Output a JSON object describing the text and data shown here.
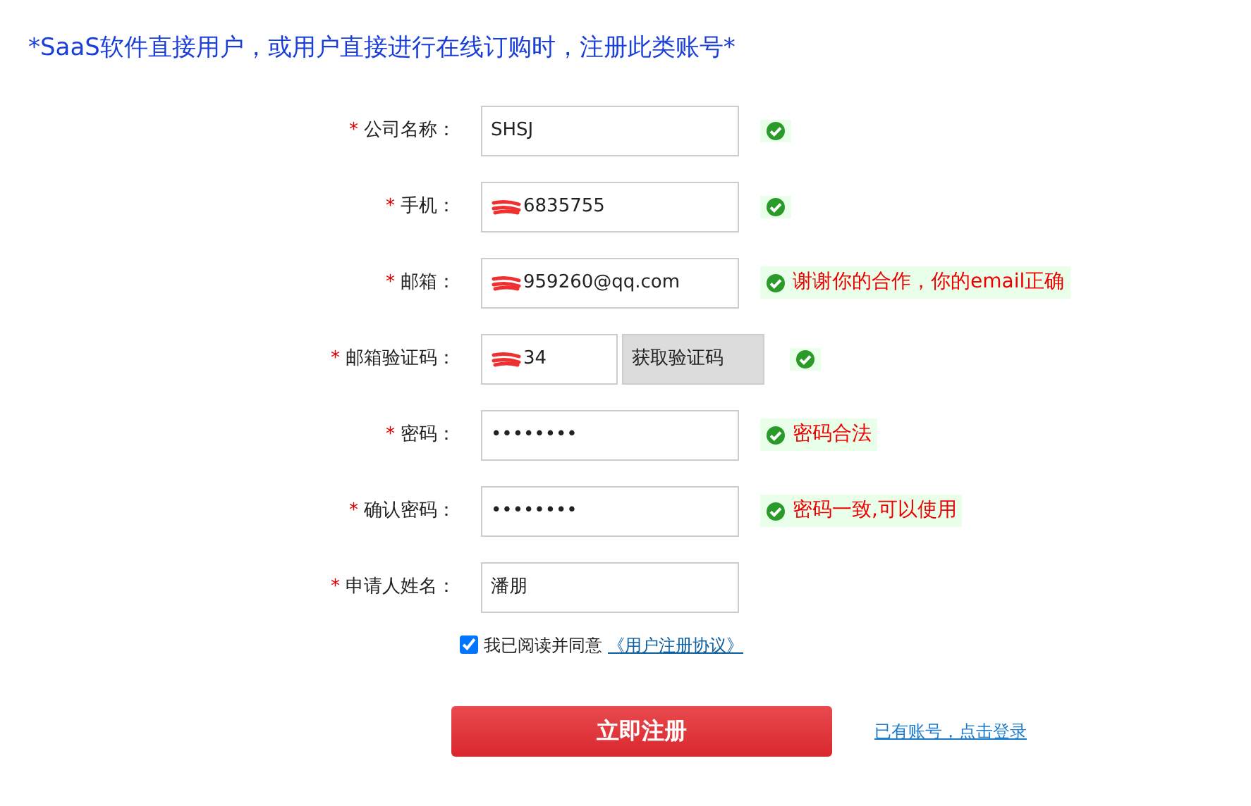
{
  "title": "*SaaS软件直接用户，或用户直接进行在线订购时，注册此类账号*",
  "fields": [
    {
      "kind": "input",
      "mark": "*",
      "label": "公司名称：",
      "value": "SHSJ",
      "redacted": false,
      "valid": true
    },
    {
      "kind": "input",
      "mark": "*",
      "label": "手机：",
      "value": "6835755",
      "redacted": true,
      "valid": true
    },
    {
      "kind": "input",
      "mark": "*",
      "label": "邮箱：",
      "value": "959260@qq.com",
      "redacted": true,
      "valid": true,
      "message": "谢谢你的合作，你的email正确"
    },
    {
      "kind": "code",
      "mark": "*",
      "label": "邮箱验证码：",
      "value": "34",
      "redacted": true,
      "valid": true,
      "button": "获取验证码"
    },
    {
      "kind": "input",
      "mark": "*",
      "label": "密码：",
      "value": "••••••••",
      "redacted": false,
      "valid": true,
      "message": "密码合法"
    },
    {
      "kind": "input",
      "mark": "*",
      "label": "确认密码：",
      "value": "••••••••",
      "redacted": false,
      "valid": true,
      "message": "密码一致,可以使用"
    },
    {
      "kind": "input",
      "mark": "*",
      "label": "申请人姓名：",
      "value": "潘朋",
      "redacted": false,
      "valid": false
    }
  ],
  "agreement": {
    "checked": true,
    "text": "我已阅读并同意",
    "link": "《用户注册协议》"
  },
  "submit": "立即注册",
  "login_link": "已有账号，点击登录"
}
